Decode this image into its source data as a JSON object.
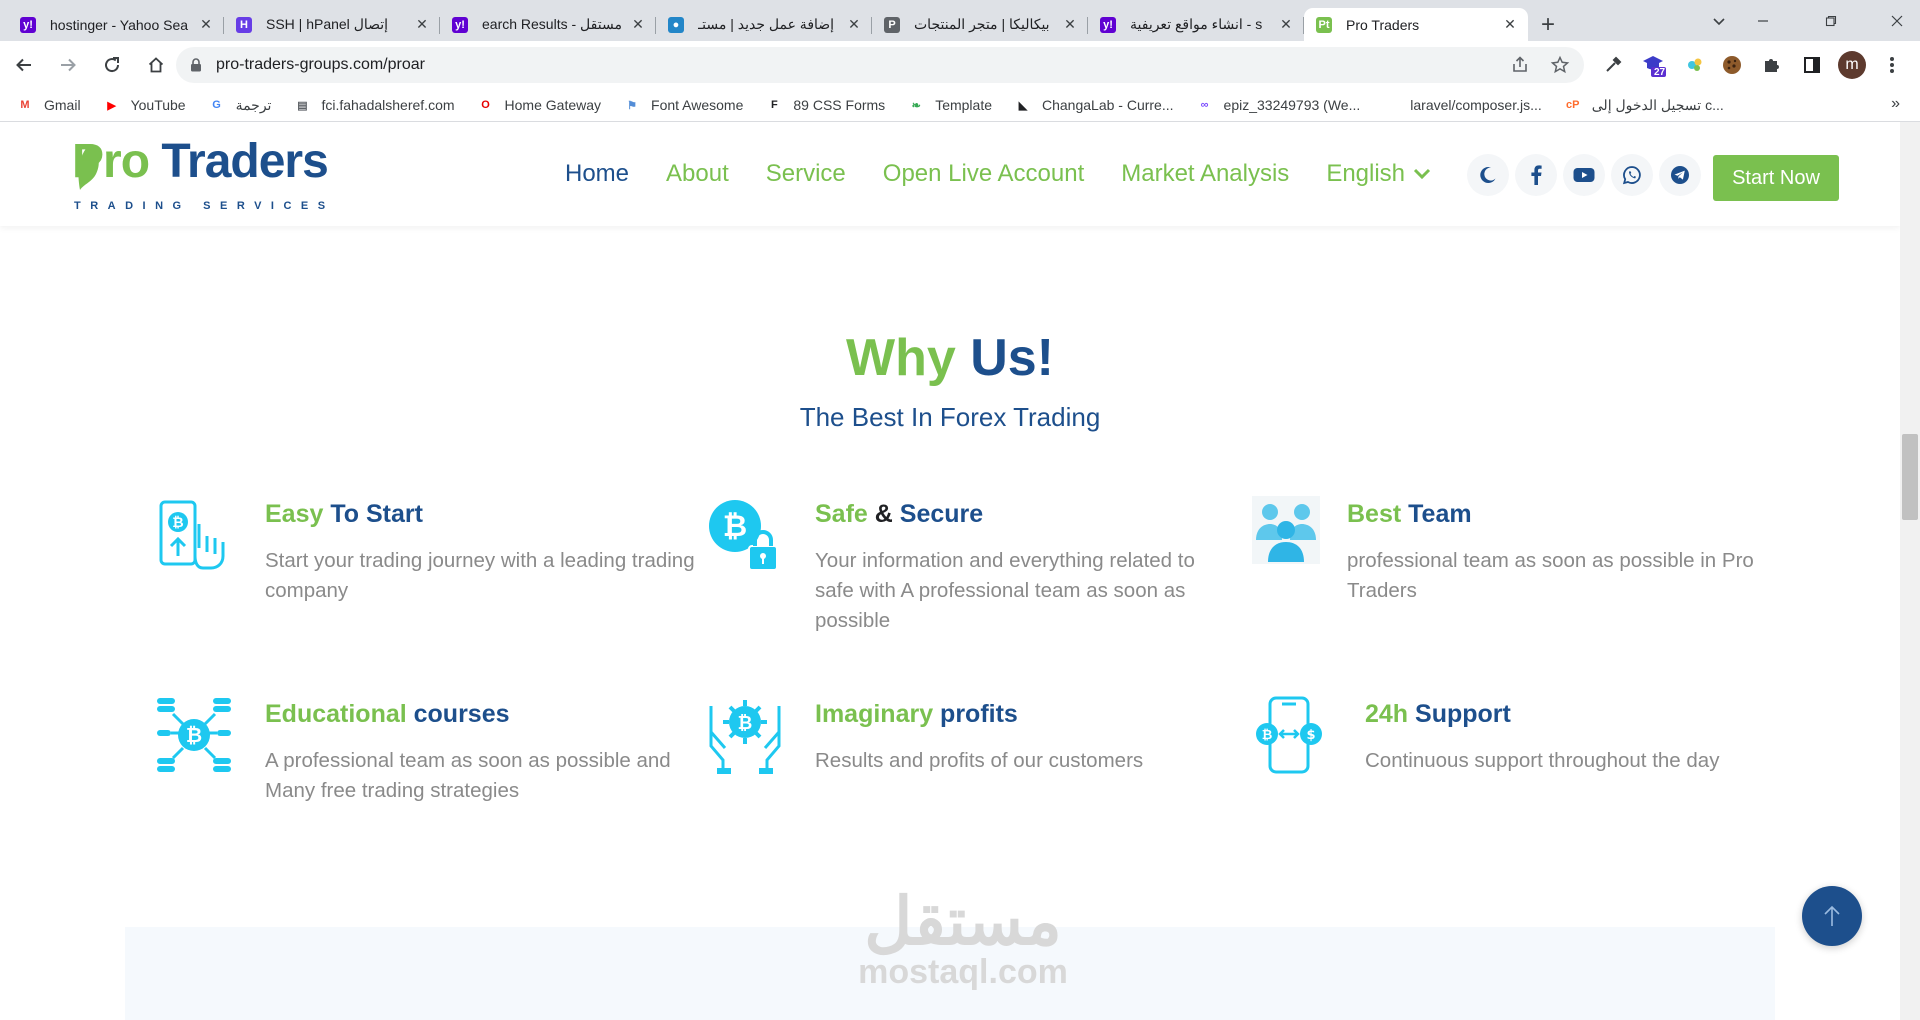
{
  "browser": {
    "tabs": [
      {
        "title": "hostinger - Yahoo Sea",
        "favicon": "yahoo-favicon",
        "color": "#6001d2",
        "glyph": "y!"
      },
      {
        "title": "SSH | hPanel إتصال",
        "favicon": "hostinger-favicon",
        "color": "#673de6",
        "glyph": "H"
      },
      {
        "title": "earch Results - مستقل",
        "favicon": "yahoo-favicon",
        "color": "#6001d2",
        "glyph": "y!"
      },
      {
        "title": "إضافة عمل جديد | مستـ",
        "favicon": "mostaql-favicon",
        "color": "#2386c8",
        "glyph": "●"
      },
      {
        "title": "بيكاليكا | متجر المنتجات",
        "favicon": "bikalika-favicon",
        "color": "#5f6368",
        "glyph": "P"
      },
      {
        "title": "انشاء مواقع تعريفية - s",
        "favicon": "yahoo-favicon",
        "color": "#6001d2",
        "glyph": "y!"
      },
      {
        "title": "Pro Traders",
        "favicon": "protraders-favicon",
        "color": "#7ac04f",
        "glyph": "Pt",
        "active": true
      }
    ],
    "url": "pro-traders-groups.com/proar",
    "extension_badge": "27",
    "profile_initial": "m",
    "bookmarks": [
      {
        "label": "Gmail",
        "icon": "gmail-icon",
        "color": "#ea4335",
        "glyph": "M"
      },
      {
        "label": "YouTube",
        "icon": "youtube-icon",
        "color": "#ff0000",
        "glyph": "▶"
      },
      {
        "label": "ترجمة",
        "icon": "translate-icon",
        "color": "#4285f4",
        "glyph": "G"
      },
      {
        "label": "fci.fahadalsheref.com",
        "icon": "page-icon",
        "color": "#5f6368",
        "glyph": "▤"
      },
      {
        "label": "Home Gateway",
        "icon": "vodafone-icon",
        "color": "#e60000",
        "glyph": "O"
      },
      {
        "label": "Font Awesome",
        "icon": "flag-icon",
        "color": "#538dd7",
        "glyph": "⚑"
      },
      {
        "label": "89 CSS Forms",
        "icon": "forms-icon",
        "color": "#202124",
        "glyph": "F"
      },
      {
        "label": "Template",
        "icon": "leaf-icon",
        "color": "#34a853",
        "glyph": "❧"
      },
      {
        "label": "ChangaLab - Curre...",
        "icon": "changalab-icon",
        "color": "#202124",
        "glyph": "◣"
      },
      {
        "label": "epiz_33249793 (We...",
        "icon": "infinity-icon",
        "color": "#7c4dff",
        "glyph": "∞"
      },
      {
        "label": "laravel/composer.js...",
        "icon": "blank-icon",
        "color": "#ffffff",
        "glyph": ""
      },
      {
        "label": "تسجيل الدخول إلى c...",
        "icon": "cpanel-icon",
        "color": "#ff6c2c",
        "glyph": "cP"
      }
    ],
    "bookmarks_more": "»"
  },
  "site": {
    "logo": {
      "pro": "Pro",
      "traders": " Traders",
      "tagline": "TRADING SERVICES"
    },
    "nav": {
      "home": "Home",
      "about": "About",
      "service": "Service",
      "open_live_account": "Open Live Account",
      "market_analysis": "Market Analysis",
      "language": "English"
    },
    "start_now": "Start Now",
    "section": {
      "title_green": "Why",
      "title_blue": " Us!",
      "subtitle": "The Best In Forex Trading"
    },
    "features": [
      {
        "t1": "Easy",
        "t2": " To Start",
        "desc": "Start your trading journey with a leading trading company"
      },
      {
        "t1": "Safe",
        "amp": " & ",
        "t2": "Secure",
        "desc": "Your information and everything related to safe with A professional team as soon as possible"
      },
      {
        "t1": "Best",
        "t2": " Team",
        "desc": "professional team as soon as possible in Pro Traders"
      },
      {
        "t1": "Educational",
        "t2": " courses",
        "desc": "A professional team as soon as possible and Many free trading strategies"
      },
      {
        "t1": "Imaginary",
        "t2": " profits",
        "desc": "Results and profits of our customers"
      },
      {
        "t1": "24h",
        "t2": " Support",
        "desc": "Continuous support throughout the day"
      }
    ],
    "watermark": {
      "arabic": "مستقل",
      "latin": "mostaql.com"
    }
  },
  "colors": {
    "green": "#7ac04f",
    "blue": "#1d4f8c",
    "icon_cyan": "#1ec8f0",
    "text_gray": "#8a8a8a"
  }
}
